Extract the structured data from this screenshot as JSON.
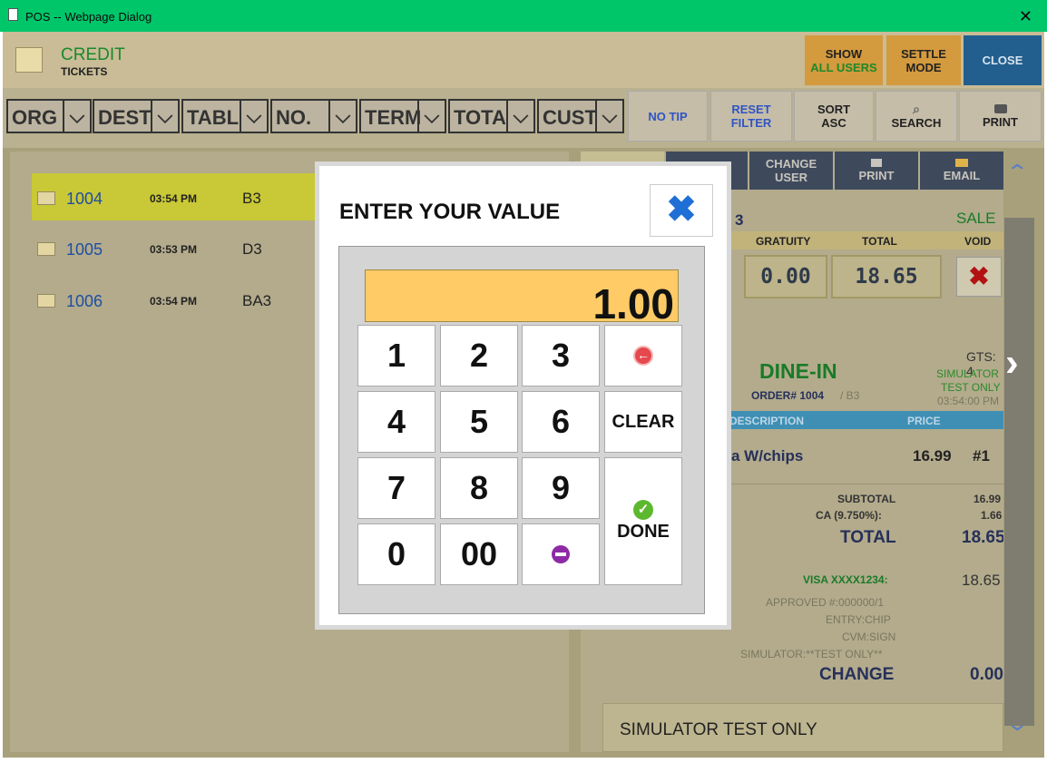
{
  "window": {
    "title": "POS -- Webpage Dialog",
    "close_glyph": "✕"
  },
  "header": {
    "title": "CREDIT",
    "subtitle": "TICKETS",
    "show_all_users": {
      "line1": "SHOW",
      "line2": "ALL USERS"
    },
    "settle_mode": {
      "line1": "SETTLE",
      "line2": "MODE"
    },
    "close": "CLOSE"
  },
  "filters": [
    {
      "label": "ORG"
    },
    {
      "label": "DEST"
    },
    {
      "label": "TABL"
    },
    {
      "label": "NO."
    },
    {
      "label": "TERM"
    },
    {
      "label": "TOTA"
    },
    {
      "label": "CUST"
    }
  ],
  "toolbar": {
    "no_tip": "NO TIP",
    "reset_filter": {
      "line1": "RESET",
      "line2": "FILTER"
    },
    "sort": {
      "line1": "SORT",
      "line2": "ASC"
    },
    "search": "SEARCH",
    "print": "PRINT"
  },
  "tickets": [
    {
      "number": "1004",
      "time": "03:54 PM",
      "table": "B3",
      "selected": true
    },
    {
      "number": "1005",
      "time": "03:53 PM",
      "table": "D3",
      "selected": false
    },
    {
      "number": "1006",
      "time": "03:54 PM",
      "table": "BA3",
      "selected": false
    }
  ],
  "detail": {
    "change_user": {
      "line1": "CHANGE",
      "line2": "USER"
    },
    "print": "PRINT",
    "email": "EMAIL",
    "type_fragment": "3",
    "sale": "SALE",
    "col_gratuity": "GRATUITY",
    "col_total": "TOTAL",
    "col_void": "VOID",
    "gratuity": "0.00",
    "total": "18.65",
    "dine_in": "DINE-IN",
    "order_label": "ORDER# 1004",
    "order_table": "/ B3",
    "gts": "GTS: 4",
    "simulator": "SIMULATOR",
    "test_only": "TEST ONLY",
    "time": "03:54:00 PM",
    "col_description": "DESCRIPTION",
    "col_price": "PRICE",
    "item_name": "a W/chips",
    "item_price": "16.99",
    "item_seat": "#1",
    "subtotal_label": "SUBTOTAL",
    "subtotal": "16.99",
    "tax_label": "CA (9.750%):",
    "tax": "1.66",
    "total_label": "TOTAL",
    "total_value": "18.65",
    "card_label": "VISA XXXX1234:",
    "card_amount": "18.65",
    "approved": "APPROVED #:000000/1",
    "entry": "ENTRY:CHIP",
    "cvm": "CVM:SIGN",
    "sim_line": "SIMULATOR:**TEST ONLY**",
    "change_label": "CHANGE",
    "change_value": "0.00",
    "footer": "SIMULATOR TEST ONLY"
  },
  "dialog": {
    "title": "ENTER YOUR VALUE",
    "close_glyph": "✖",
    "value": "1.00",
    "keys": {
      "k1": "1",
      "k2": "2",
      "k3": "3",
      "k4": "4",
      "k5": "5",
      "k6": "6",
      "k7": "7",
      "k8": "8",
      "k9": "9",
      "k0": "0",
      "k00": "00",
      "clear": "CLEAR",
      "done": "DONE"
    }
  },
  "icons": {
    "backspace": "backspace-icon",
    "minus": "minus-icon",
    "check": "check-icon",
    "x": "void-x-icon"
  },
  "colors": {
    "titlebar": "#00c66a",
    "credit_green": "#1b8a2a",
    "show_users": "#f6a423",
    "settle": "#f6a423",
    "close": "#1e6fb0",
    "display": "#ffcb66",
    "selected_row": "#ecec2a",
    "dialog_x": "#1f6fd6"
  }
}
